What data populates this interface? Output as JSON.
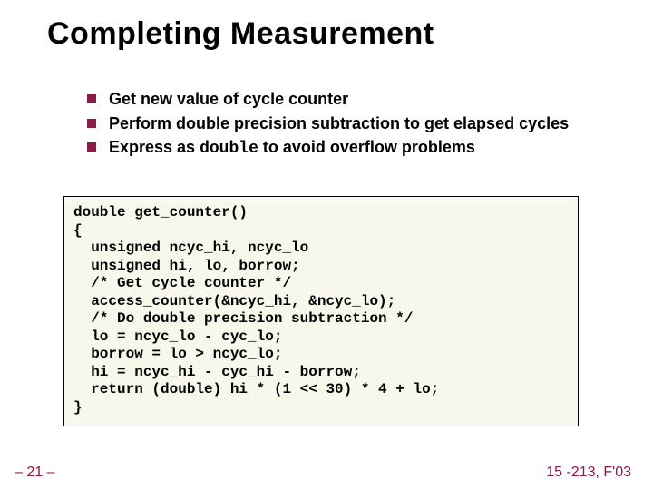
{
  "title": "Completing Measurement",
  "bullets": [
    {
      "prefix": "Get new value of cycle counter"
    },
    {
      "prefix": "Perform double precision subtraction to get elapsed cycles"
    },
    {
      "prefix": "Express as ",
      "mono": "double",
      "suffix": " to avoid overflow problems"
    }
  ],
  "code": "double get_counter()\n{\n  unsigned ncyc_hi, ncyc_lo\n  unsigned hi, lo, borrow;\n  /* Get cycle counter */\n  access_counter(&ncyc_hi, &ncyc_lo);\n  /* Do double precision subtraction */\n  lo = ncyc_lo - cyc_lo;\n  borrow = lo > ncyc_lo;\n  hi = ncyc_hi - cyc_hi - borrow;\n  return (double) hi * (1 << 30) * 4 + lo;\n}",
  "footer": {
    "left": "– 21 –",
    "right": "15 -213, F'03"
  }
}
